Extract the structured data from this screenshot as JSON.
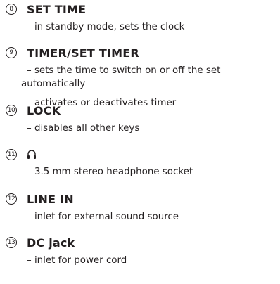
{
  "items": [
    {
      "number": "8",
      "title": "SET TIME",
      "lines": [
        "– in standby mode, sets the clock"
      ]
    },
    {
      "number": "9",
      "title": "TIMER/SET TIMER",
      "lines": [
        "– sets the time to switch on or off the set automatically",
        "– activates or deactivates timer"
      ]
    },
    {
      "number": "10",
      "title": "LOCK",
      "lines": [
        "– disables all other keys"
      ]
    },
    {
      "number": "11",
      "icon": "headphone-icon",
      "lines": [
        "– 3.5 mm stereo headphone socket"
      ]
    },
    {
      "number": "12",
      "title": "LINE IN",
      "lines": [
        "– inlet for external sound source"
      ]
    },
    {
      "number": "13",
      "title": "DC jack",
      "lines": [
        "– inlet for power cord"
      ]
    }
  ]
}
